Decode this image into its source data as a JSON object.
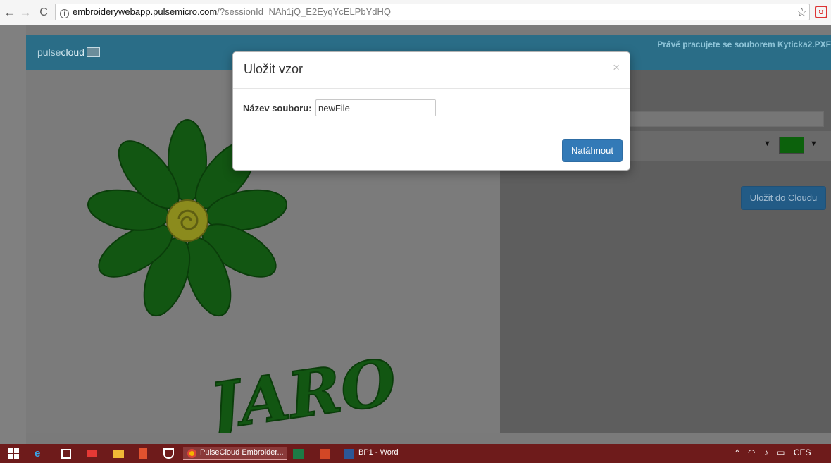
{
  "browser": {
    "url_host": "embroiderywebapp.pulsemicro.com",
    "url_rest": "/?sessionId=NAh1jQ_E2EyqYcELPbYdHQ",
    "back_glyph": "←",
    "forward_glyph": "→",
    "reload_glyph": "C",
    "info_glyph": "i",
    "star_glyph": "☆",
    "extension_glyph": "ʊ"
  },
  "app": {
    "logo_light": "pulse",
    "logo_strong": "cloud",
    "working_file_text": "Právě pracujete se souborem Kyticka2.PXF",
    "save_to_cloud_label": "Uložit do Cloudu",
    "design_text": "JARO",
    "dropdown_arrow": "▼",
    "thread_color": "#0c610c"
  },
  "dialog": {
    "title": "Uložit vzor",
    "close_glyph": "×",
    "filename_label": "Název souboru:",
    "filename_value": "newFile",
    "confirm_label": "Natáhnout"
  },
  "taskbar": {
    "ie_glyph": "e",
    "chrome_task_label": "PulseCloud Embroider...",
    "word_task_label": "BP1 - Word",
    "tray_chevron": "^",
    "language": "CES"
  },
  "colors": {
    "header_bg": "#2a6d87",
    "primary_button": "#337ab7",
    "taskbar_bg": "#6e1b1b"
  }
}
